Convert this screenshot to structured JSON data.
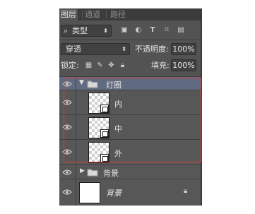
{
  "tabs": [
    {
      "label": "图层",
      "active": true
    },
    {
      "label": "通道",
      "active": false
    },
    {
      "label": "路径",
      "active": false
    }
  ],
  "filter": {
    "kind_label": "类型",
    "icons": [
      "image-filter-icon",
      "adjustment-filter-icon",
      "type-filter-icon",
      "shape-filter-icon",
      "smart-object-filter-icon"
    ]
  },
  "blend": {
    "mode": "穿透",
    "opacity_label": "不透明度:",
    "opacity_value": "100%"
  },
  "lock": {
    "label": "锁定:",
    "fill_label": "填充:",
    "fill_value": "100%"
  },
  "layers": [
    {
      "name": "灯圈",
      "type": "group",
      "expanded": true,
      "selected": true
    },
    {
      "name": "内",
      "type": "layer",
      "in_group": true
    },
    {
      "name": "中",
      "type": "layer",
      "in_group": true
    },
    {
      "name": "外",
      "type": "layer",
      "in_group": true
    },
    {
      "name": "背景",
      "type": "group",
      "expanded": false
    },
    {
      "name": "背景",
      "type": "background",
      "locked": true
    }
  ],
  "colors": {
    "panel": "#535353",
    "selected_row": "#606a80",
    "highlight_box": "#d6403a"
  }
}
